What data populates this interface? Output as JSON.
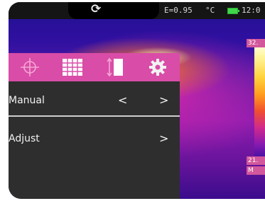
{
  "status": {
    "emissivity": "E=0.95",
    "unit": "°C",
    "time": "12:0"
  },
  "icons": {
    "refresh": "refresh-icon",
    "battery": "battery-icon",
    "crosshair": "crosshair-icon",
    "grid": "grid-icon",
    "scale": "temperature-scale-icon",
    "settings": "gear-icon"
  },
  "scale": {
    "max_label": "32.",
    "min_label": "21.",
    "mode_label": "M"
  },
  "menu": {
    "rows": [
      {
        "label": "Manual",
        "left_arrow": "<",
        "right_arrow": ">"
      },
      {
        "label": "Adjust",
        "right_arrow": ">"
      }
    ]
  },
  "colors": {
    "tab_bar": "#d94ca7",
    "menu_bg": "#2e2e2e",
    "battery": "#3fd84a"
  }
}
